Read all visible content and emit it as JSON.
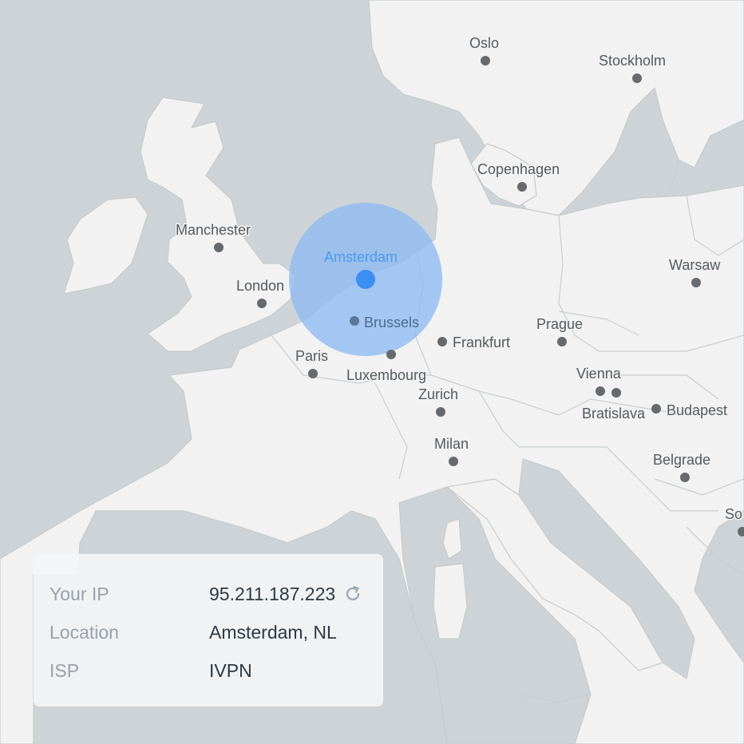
{
  "map": {
    "selected_location": {
      "label": "Amsterdam"
    },
    "cities": [
      {
        "name": "Oslo"
      },
      {
        "name": "Stockholm"
      },
      {
        "name": "Copenhagen"
      },
      {
        "name": "Manchester"
      },
      {
        "name": "London"
      },
      {
        "name": "Warsaw"
      },
      {
        "name": "Brussels"
      },
      {
        "name": "Frankfurt"
      },
      {
        "name": "Prague"
      },
      {
        "name": "Paris"
      },
      {
        "name": "Luxembourg"
      },
      {
        "name": "Zurich"
      },
      {
        "name": "Vienna"
      },
      {
        "name": "Bratislava"
      },
      {
        "name": "Budapest"
      },
      {
        "name": "Milan"
      },
      {
        "name": "Belgrade"
      },
      {
        "name": "So"
      }
    ]
  },
  "info_panel": {
    "ip_label": "Your IP",
    "ip_value": "95.211.187.223",
    "location_label": "Location",
    "location_value": "Amsterdam, NL",
    "isp_label": "ISP",
    "isp_value": "IVPN",
    "refresh_icon": "refresh-icon"
  },
  "colors": {
    "water": "#cdd3d6",
    "land": "#f2f2f2",
    "accent": "#3d8ef2",
    "selection_circle": "#8ebaf2"
  }
}
